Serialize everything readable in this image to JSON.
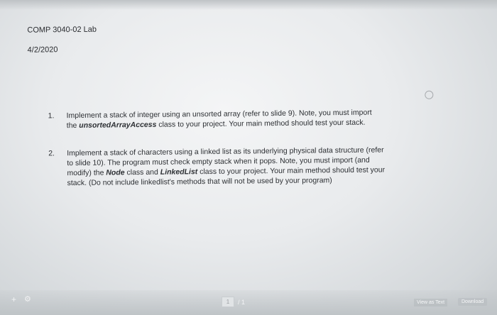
{
  "document": {
    "course": "COMP 3040-02 Lab",
    "date": "4/2/2020",
    "task1": {
      "number": "1.",
      "line1_a": "Implement a stack of integer using an unsorted array (refer to slide 9). Note, you must import",
      "line2_a": "the ",
      "line2_b": "unsortedArrayAccess",
      "line2_c": " class to your project. Your main method should test your stack."
    },
    "task2": {
      "number": "2.",
      "line1": "Implement a stack of characters using a linked list as its underlying physical data structure (refer",
      "line2": "to slide 10). The program must check empty stack when it pops. Note, you must import (and",
      "line3_a": "modify) the ",
      "line3_b": "Node",
      "line3_c": " class and ",
      "line3_d": "LinkedList",
      "line3_e": " class to your project. Your main method should test your",
      "line4": "stack. (Do not include linkedlist's methods that will not be used by your program)"
    }
  },
  "viewer": {
    "page_current": "1",
    "page_total": "/ 1",
    "view_as_text": "View as Text",
    "download": "Download",
    "plus_glyph": "+",
    "gear_glyph": "⚙"
  }
}
